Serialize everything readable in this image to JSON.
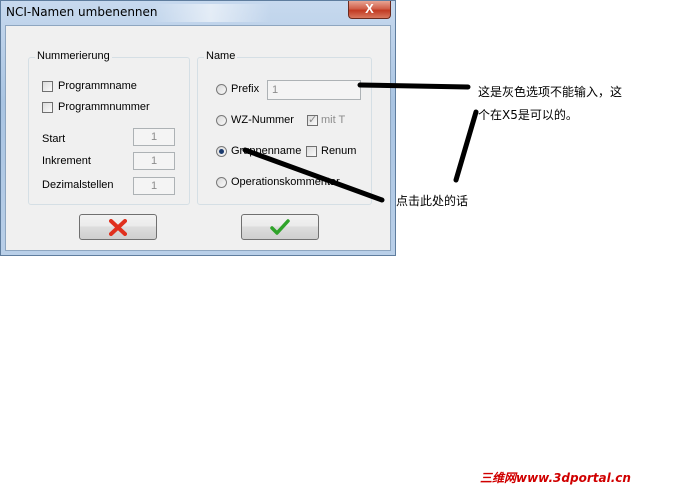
{
  "window": {
    "title": "NCI-Namen umbenennen",
    "close_label": "X"
  },
  "numbering_group": {
    "caption": "Nummerierung",
    "program_name": {
      "label": "Programmname",
      "checked": false
    },
    "program_number": {
      "label": "Programmnummer",
      "checked": false
    },
    "start": {
      "label": "Start",
      "value": "1"
    },
    "increment": {
      "label": "Inkrement",
      "value": "1"
    },
    "decimals": {
      "label": "Dezimalstellen",
      "value": "1"
    }
  },
  "name_group": {
    "caption": "Name",
    "prefix": {
      "label": "Prefix",
      "value": "1",
      "selected": false
    },
    "tool_number": {
      "label": "WZ-Nummer",
      "selected": false
    },
    "with_t": {
      "label": "mit T",
      "checked": true,
      "disabled": true
    },
    "group_name": {
      "label": "Gruppenname",
      "selected": true
    },
    "renum": {
      "label": "Renum",
      "checked": false
    },
    "operation_comment": {
      "label": "Operationskommentar",
      "selected": false
    }
  },
  "buttons": {
    "cancel_icon": "red-x-icon",
    "ok_icon": "green-check-icon",
    "cancel_color": "#e0301e",
    "ok_color": "#2fa32a"
  },
  "annotations": {
    "note1": "这是灰色选项不能输入，这个在X5是可以的。",
    "note2": "点击此处的话"
  },
  "watermark": "三维网www.3dportal.cn"
}
